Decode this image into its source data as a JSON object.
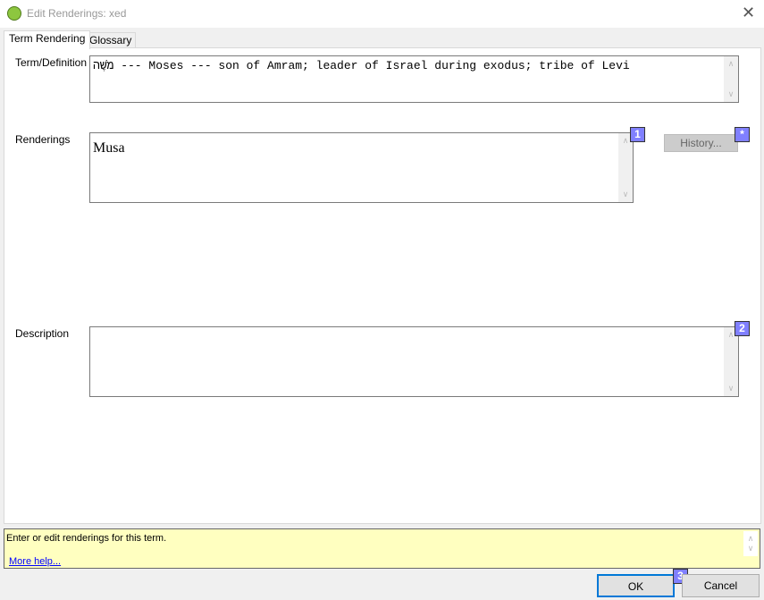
{
  "window": {
    "title": "Edit Renderings: xed",
    "close_icon": "close-icon"
  },
  "tabs": [
    {
      "label": "Term Rendering",
      "active": true
    },
    {
      "label": "Glossary",
      "active": false
    }
  ],
  "term": {
    "label": "Term/Definition",
    "value": "מֹשֶׁה --- Moses --- son of Amram; leader of Israel during exodus; tribe of Levi"
  },
  "renderings": {
    "label": "Renderings",
    "value": "Musa",
    "badge": "1"
  },
  "history": {
    "label": "History...",
    "badge": "*"
  },
  "description": {
    "label": "Description",
    "value": "",
    "badge": "2"
  },
  "help": {
    "text": "Enter or edit renderings for this term.",
    "link": "More help..."
  },
  "buttons": {
    "ok": "OK",
    "ok_badge": "3",
    "cancel": "Cancel"
  },
  "colors": {
    "help_bg": "#ffffc0",
    "badge": "#8080ff",
    "focus": "#0078d7"
  }
}
